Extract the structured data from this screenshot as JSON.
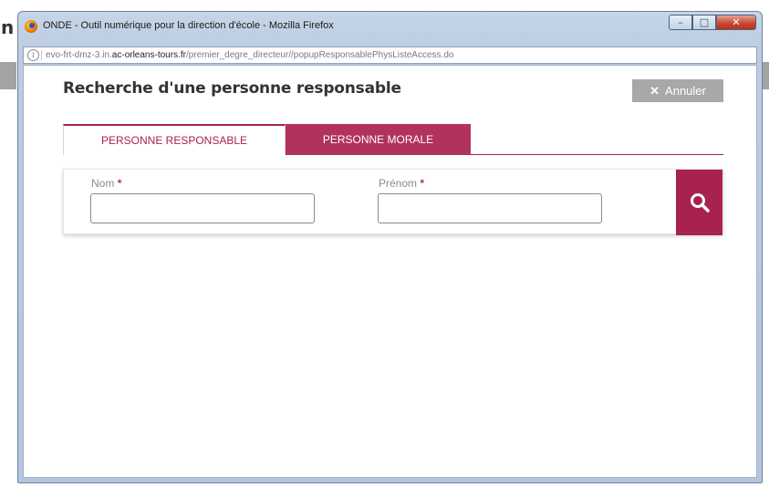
{
  "background": {
    "partial_letter": "n"
  },
  "window": {
    "title": "ONDE - Outil numérique pour la direction d'école - Mozilla Firefox",
    "controls": {
      "minimize": "–",
      "maximize": "□",
      "close": "✕"
    }
  },
  "urlbar": {
    "info_icon": "i",
    "prefix": "evo-frt-dmz-3.in.",
    "host": "ac-orleans-tours.fr",
    "path": "/premier_degre_directeur//popupResponsablePhysListeAccess.do"
  },
  "page": {
    "title": "Recherche d'une personne responsable",
    "cancel_label": "Annuler",
    "cancel_icon": "close-icon"
  },
  "tabs": [
    {
      "label": "PERSONNE RESPONSABLE",
      "active": true
    },
    {
      "label": "PERSONNE MORALE",
      "active": false
    }
  ],
  "form": {
    "nom_label": "Nom",
    "prenom_label": "Prénom",
    "required_marker": "*",
    "nom_value": "",
    "prenom_value": "",
    "search_icon": "search-icon"
  },
  "colors": {
    "accent": "#a8224f",
    "tab_inactive": "#b2325f",
    "cancel_bg": "#a8a8a8"
  }
}
